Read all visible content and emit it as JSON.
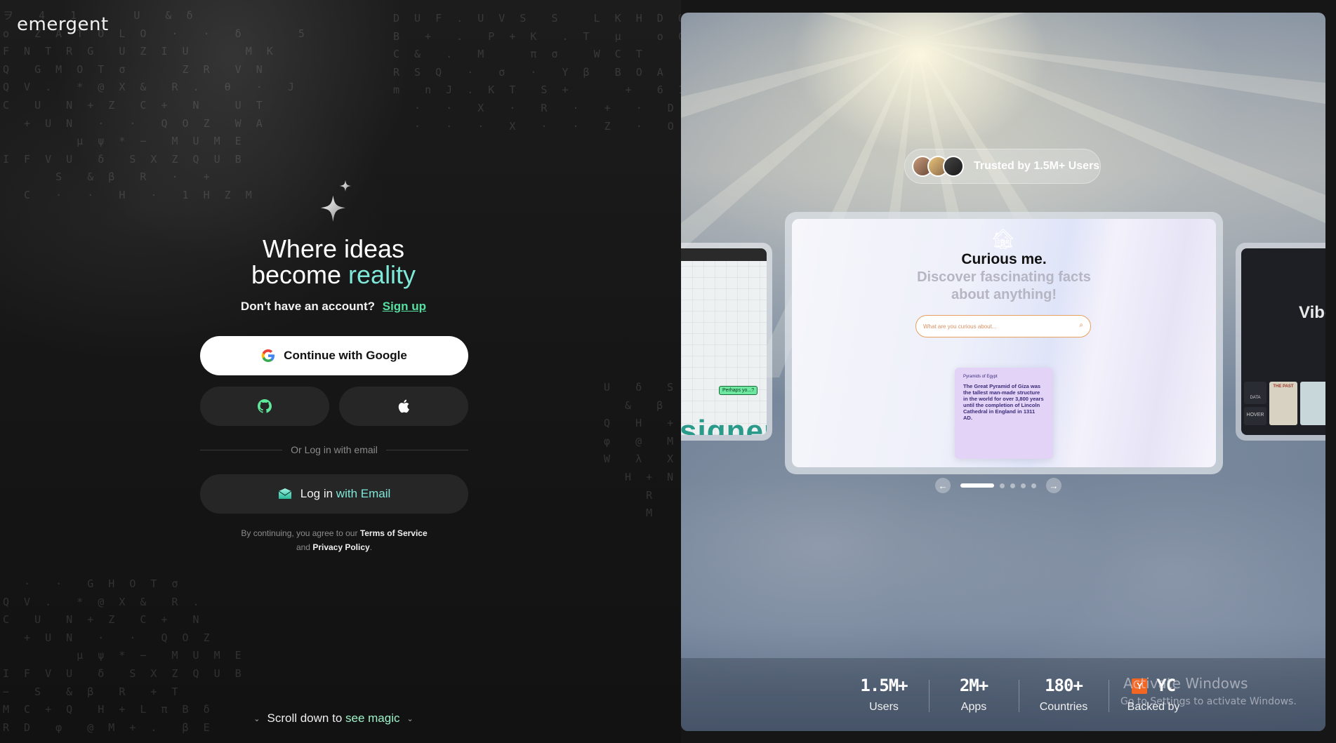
{
  "brand": {
    "logo_text": "emergent"
  },
  "hero": {
    "line1": "Where ideas",
    "line2_word1": "become",
    "line2_word2": "reality"
  },
  "signup": {
    "prompt": "Don't have an account?",
    "link_label": "Sign up"
  },
  "auth": {
    "google_label": "Continue with Google",
    "github_icon": "github-icon",
    "apple_icon": "apple-icon",
    "divider_text": "Or Log in with email",
    "email_label_plain": "Log in",
    "email_label_accent": "with Email"
  },
  "terms": {
    "prefix": "By continuing, you agree to our",
    "tos": "Terms of Service",
    "and": "and",
    "privacy": "Privacy Policy",
    "suffix": "."
  },
  "scroll_hint": {
    "plain": "Scroll down to",
    "accent": "see magic"
  },
  "showcase": {
    "trusted_text": "Trusted by 1.5M+ Users",
    "main_card": {
      "title": "Curious me.",
      "subtitle": "Discover fascinating facts about anything!",
      "input_placeholder": "What are you curious about...",
      "fact_title": "Pyramids of Egypt",
      "fact_body": "The Great Pyramid of Giza was the tallest man-made structure in the world for over 3,800 years until the completion of Lincoln Cathedral in England in 1311 AD."
    },
    "left_card": {
      "bubble": "Perhaps yo...?",
      "big_text": "signer"
    },
    "right_card": {
      "big_text": "Vibe",
      "tile1": "DATA",
      "tile2": "HOVER",
      "tile3": "THE PAST"
    },
    "pager": {
      "active_index": 0,
      "count": 5
    }
  },
  "stats": [
    {
      "num": "1.5M+",
      "label": "Users"
    },
    {
      "num": "2M+",
      "label": "Apps"
    },
    {
      "num": "180+",
      "label": "Countries"
    },
    {
      "num": "YC",
      "badge": "Y",
      "label": "Backed by"
    }
  ],
  "windows_watermark": {
    "title": "Activate Windows",
    "sub": "Go to Settings to activate Windows."
  },
  "colors": {
    "accent_teal": "#7fe8d8",
    "accent_green": "#57e0a0",
    "bg": "#161616"
  }
}
